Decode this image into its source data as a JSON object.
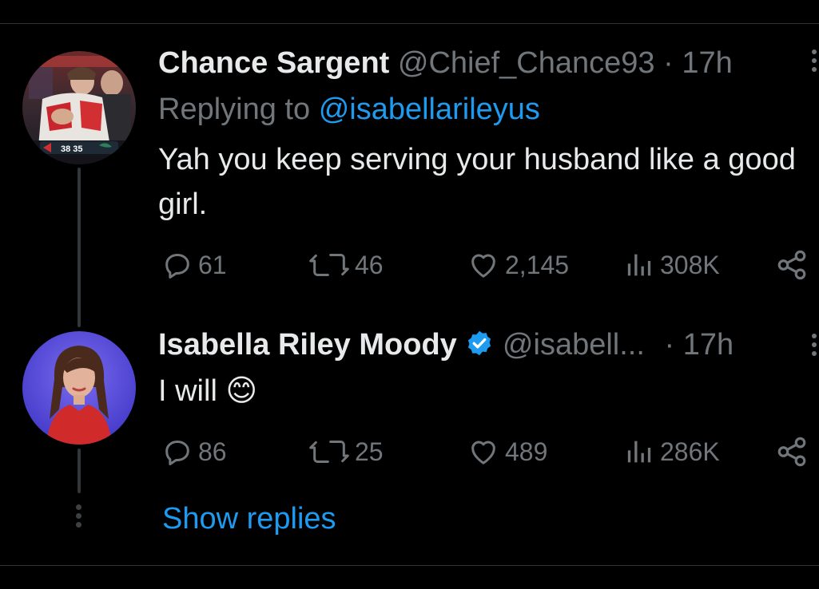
{
  "colors": {
    "background": "#000000",
    "text_primary": "#e7e9ea",
    "text_muted": "#71767b",
    "accent_link": "#1d9bf0",
    "verified_badge": "#1d9bf0"
  },
  "tweets": [
    {
      "author_name": "Chance Sargent",
      "handle": "@Chief_Chance93",
      "separator": "·",
      "time": "17h",
      "reply_prefix": "Replying to",
      "reply_to": "@isabellarileyus",
      "text": "Yah you keep serving your husband like a good girl.",
      "avatar_icon": "football-players-photo-icon",
      "avatar_scoreboard": "38 35",
      "actions": {
        "replies": "61",
        "reposts": "46",
        "likes": "2,145",
        "views": "308K"
      }
    },
    {
      "author_name": "Isabella Riley Moody",
      "verified": true,
      "handle": "@isabell...",
      "separator": "·",
      "time": "17h",
      "text": "I will 😊",
      "avatar_icon": "woman-portrait-photo-icon",
      "actions": {
        "replies": "86",
        "reposts": "25",
        "likes": "489",
        "views": "286K"
      }
    }
  ],
  "show_replies": "Show replies"
}
